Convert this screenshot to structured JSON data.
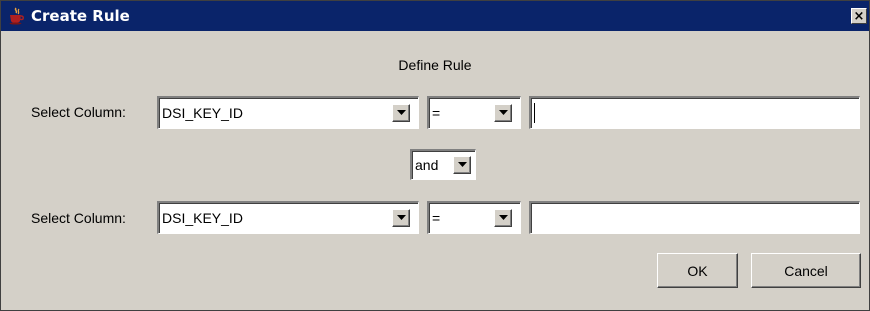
{
  "window": {
    "title": "Create Rule",
    "close_glyph": "×",
    "icon": "java-coffee-cup-icon",
    "titlebar_color": "#0a246a",
    "background_color": "#d4d0c8"
  },
  "heading": "Define Rule",
  "rules": [
    {
      "label": "Select Column:",
      "column": "DSI_KEY_ID",
      "operator": "=",
      "value": ""
    },
    {
      "label": "Select Column:",
      "column": "DSI_KEY_ID",
      "operator": "=",
      "value": ""
    }
  ],
  "conjunction": "and",
  "buttons": {
    "ok": "OK",
    "cancel": "Cancel"
  }
}
